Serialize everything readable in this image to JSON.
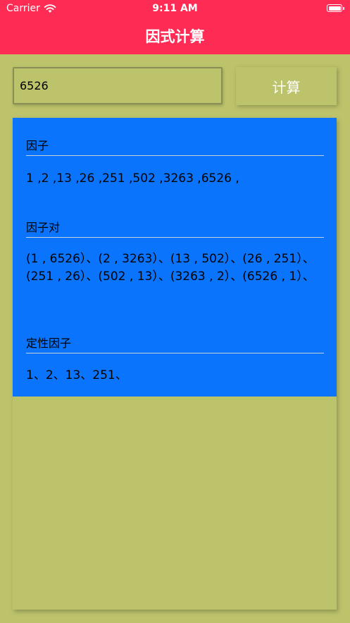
{
  "status_bar": {
    "carrier": "Carrier",
    "time": "9:11 AM"
  },
  "nav": {
    "title": "因式计算"
  },
  "input": {
    "value": "6526"
  },
  "button": {
    "label": "计算"
  },
  "results": {
    "factors": {
      "title": "因子",
      "content": "1 ,2 ,13 ,26 ,251 ,502 ,3263 ,6526 ,"
    },
    "factor_pairs": {
      "title": "因子对",
      "content": "(1 , 6526）、(2 , 3263）、(13 , 502）、(26 , 251）、(251 , 26）、(502 , 13）、(3263 , 2）、(6526 , 1）、"
    },
    "qualitative_factors": {
      "title": "定性因子",
      "content": "1、2、13、251、"
    }
  },
  "colors": {
    "nav_bg": "#fe2c54",
    "page_bg": "#bdc36b",
    "panel_bg": "#0a74fc"
  }
}
